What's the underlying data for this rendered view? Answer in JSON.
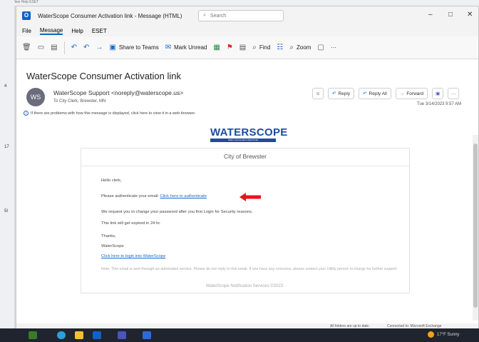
{
  "window": {
    "title": "WaterScope Consumer Activation link - Message (HTML)",
    "search_placeholder": "Search",
    "app_icon": "outlook-icon"
  },
  "menu": {
    "file": "File",
    "message": "Message",
    "help": "Help",
    "eset": "ESET"
  },
  "ribbon": {
    "share_to_teams": "Share to Teams",
    "mark_unread": "Mark Unread",
    "find": "Find",
    "zoom": "Zoom",
    "more": "···"
  },
  "email": {
    "subject": "WaterScope Consumer Activation link",
    "avatar_initials": "WS",
    "sender": "WaterScope Support <noreply@waterscope.us>",
    "to": "To  City Clerk, Brewster, MN",
    "date": "Tue 3/14/2023 9:57 AM",
    "info_bar": "If there are problems with how this message is displayed, click here to view it in a web browser.",
    "actions": {
      "reply": "Reply",
      "reply_all": "Reply All",
      "forward": "Forward"
    }
  },
  "body": {
    "logo_text": "WATERSCOPE",
    "logo_tagline": "Water Consumption Web Portal",
    "city": "City of Brewster",
    "greeting": "Hello clerk,",
    "authenticate_prefix": "Please authenticate your email:",
    "authenticate_link": "Click here to authenticate",
    "password_notice": "We request you to change your password after you first Login for Security reasons.",
    "expiry": "This link will get expired in 24 hr.",
    "thanks": "Thanks,",
    "signature": "WaterScope",
    "login_link": "Click here to login into WaterScope",
    "note": "Note: This email is sent through an automated service. Please do not reply to this email. If you have any concerns, please contact your Utility person in-charge for further support.",
    "footer": "WaterScope Notification Services ©2023"
  },
  "status_bar": {
    "left": "All folders are up to date.",
    "right": "Connected to: Microsoft Exchange"
  },
  "taskbar": {
    "weather": "17°F Sunny"
  },
  "colors": {
    "accent": "#0f62c8",
    "logo": "#1d4c9e",
    "arrow": "#e8141b"
  }
}
